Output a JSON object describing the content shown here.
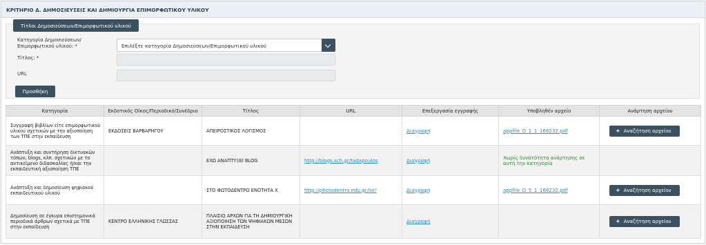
{
  "section": {
    "title": "ΚΡΙΤΗΡΙΟ Δ. ΔΗΜΟΣΙΕΥΣΕΙΣ ΚΑΙ ΔΗΜΙΟΥΡΓΙΑ ΕΠΙΜΟΡΦΩΤΙΚΟΥ ΥΛΙΚΟΥ"
  },
  "form": {
    "tab_label": "Τίτλοι Δημοσιεύσεων/Επιμορφωτικού υλικού",
    "category_label_1": "Κατηγορία Δημοσιεύσεων/",
    "category_label_2": "Επιμορφωτικού υλικού: *",
    "category_selected": "Επιλέξτε κατηγορία Δημοσιεύσεων/Επιμορφωτικού υλικού",
    "title_label": "Τίτλος: *",
    "title_value": "",
    "url_label": "URL",
    "url_value": "",
    "submit_label": "Προσθήκη"
  },
  "table": {
    "headers": [
      "Κατηγορία",
      "Εκδοτικός Οίκος/Περιοδικό/Συνέδριο",
      "Τίτλος",
      "URL",
      "Επεξεργασία εγγραφής",
      "Υποβληθέν αρχείο",
      "Ανάρτηση αρχείου"
    ],
    "rows": [
      {
        "category": "Συγγραφή βιβλίων είτε επιμορφωτικού υλικού σχετικών με την αξιοποίηση των ΤΠΕ στην εκπαίδευση",
        "publisher": "ΕΚΔΟΣΕΙΣ ΒΑΡΒΑΡΗΓΟΥ",
        "title": "ΑΠΕΙΡΟΣΤΙΚΟΣ ΛΟΓΙΣΜΟΣ",
        "url": "",
        "action": "Διαγραφή",
        "file": "appfile_D_1_1_168232.pdf",
        "upload": "Αναζήτηση αρχείου"
      },
      {
        "category": "Ανάπτυξη και συντήρηση δικτυακών τόπων, blogs, κλπ. σχετικών με το αντικείμενο διδασκαλίας ή/και την εκπαιδευτική αξιοποίηση ΤΠΕ",
        "publisher": "",
        "title": "ΕΧΩ ΑΝΑΠΤΥΞΕΙ BLOG",
        "url": "http://blogs.sch.gr/tadapoulos",
        "action": "Διαγραφή",
        "file": "",
        "upload": "",
        "note": "Χωρίς δυνατότητα ανάρτησης σε αυτή την κατηγορία"
      },
      {
        "category": "Ανάπτυξη και δημοσίευση ψηφιακού εκπαιδευτικού υλικού",
        "publisher": "",
        "title": "ΣΤΟ ΦΩΤΟΔΕΝΤΡΟ ΕΝΟΤΗΤΑ Χ",
        "url": "http://photodentro.edu.gr/lor/",
        "action": "Διαγραφή",
        "file": "appfile_D_5_1_168232.pdf",
        "upload": "Αναζήτηση αρχείου"
      },
      {
        "category": "Δημοσίευση σε έγκυρα επιστημονικά περιοδικά άρθρων σχετικά με ΤΠΕ στην εκπαίδευση",
        "publisher": "ΚΕΝΤΡΟ ΕΛΛΗΝΙΚΗΣ ΓΛΩΣΣΑΣ",
        "title": "ΠΛΑΙΣΙΟ ΑΡΧΩΝ ΓΙΑ ΤΗ ΔΗΜΙΟΥΡΓΙΚΗ ΑΞΙΟΠΟΙΗΣΗ ΤΩΝ ΨΗΦΙΑΚΩΝ ΜΕΣΩΝ ΣΤΗΝ ΕΚΠΑΙΔΕΥΣΗ",
        "url": "",
        "action": "Διαγραφή",
        "file": "",
        "upload": "Αναζήτηση αρχείου"
      }
    ]
  },
  "colors": {
    "dark_button": "#3c5160",
    "link": "#2a8cc4",
    "note_green": "#2c8a2c",
    "header_bg": "#eaf0f6"
  },
  "icons": {
    "upload": "plus-icon",
    "select": "chevron-down-icon"
  }
}
